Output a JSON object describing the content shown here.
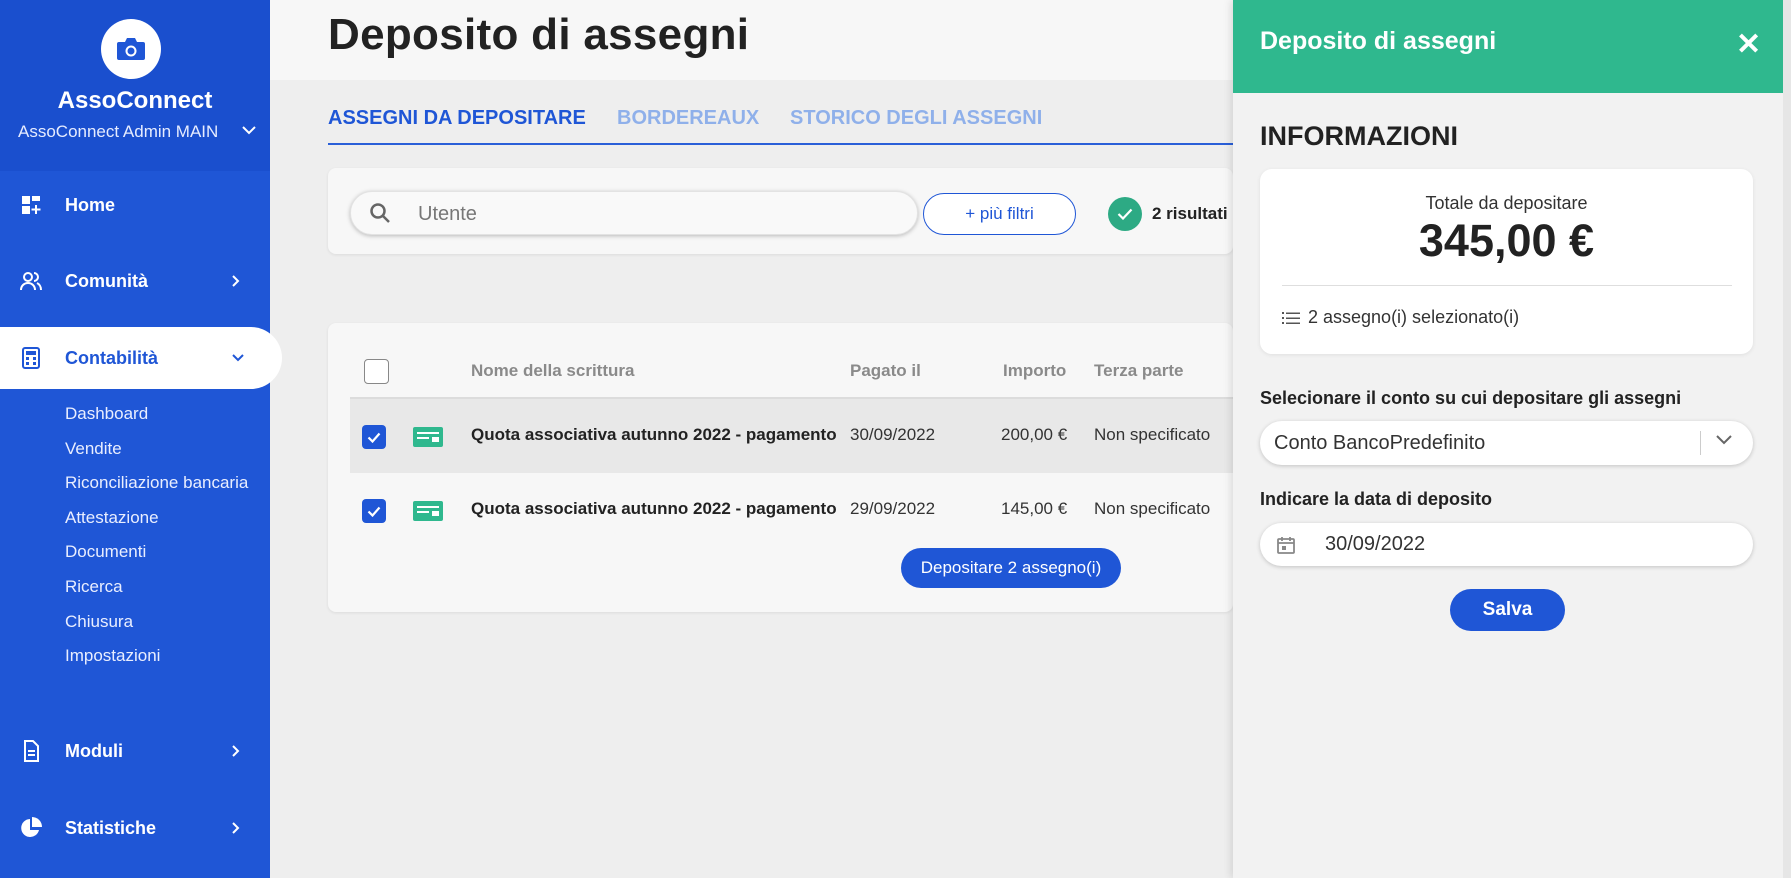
{
  "sidebar": {
    "app_name": "AssoConnect",
    "account": "AssoConnect Admin MAIN",
    "items": [
      {
        "label": "Home"
      },
      {
        "label": "Comunità"
      },
      {
        "label": "Contabilità"
      },
      {
        "label": "Moduli"
      },
      {
        "label": "Statistiche"
      }
    ],
    "subitems": [
      "Dashboard",
      "Vendite",
      "Riconciliazione bancaria",
      "Attestazione",
      "Documenti",
      "Ricerca",
      "Chiusura",
      "Impostazioni"
    ]
  },
  "main": {
    "title": "Deposito di assegni",
    "tabs": [
      {
        "label": "ASSEGNI DA DEPOSITARE",
        "active": true
      },
      {
        "label": "BORDEREAUX",
        "active": false
      },
      {
        "label": "STORICO DEGLI ASSEGNI",
        "active": false
      }
    ],
    "search_placeholder": "Utente",
    "more_filters": "+ più filtri",
    "results": "2 risultati",
    "table": {
      "headers": [
        "Nome della scrittura",
        "Pagato il",
        "Importo",
        "Terza parte"
      ],
      "rows": [
        {
          "name": "Quota associativa autunno 2022 - pagamento",
          "date": "30/09/2022",
          "amount": "200,00 €",
          "third_party": "Non specificato",
          "checked": true
        },
        {
          "name": "Quota associativa autunno 2022 - pagamento",
          "date": "29/09/2022",
          "amount": "145,00 €",
          "third_party": "Non specificato",
          "checked": true
        }
      ]
    },
    "deposit_button": "Depositare 2 assegno(i)"
  },
  "panel": {
    "title": "Deposito di assegni",
    "section_title": "INFORMAZIONI",
    "total_label": "Totale da depositare",
    "total_value": "345,00 €",
    "selected_text": "2 assegno(i) selezionato(i)",
    "account_label": "Selecionare il conto su cui depositare gli assegni",
    "account_value": "Conto BancoPredefinito",
    "date_label": "Indicare la data di deposito",
    "date_value": "30/09/2022",
    "save_label": "Salva"
  },
  "colors": {
    "sidebar": "#1f56d6",
    "accent_green": "#2fb88e",
    "primary_blue": "#1f56d6"
  }
}
